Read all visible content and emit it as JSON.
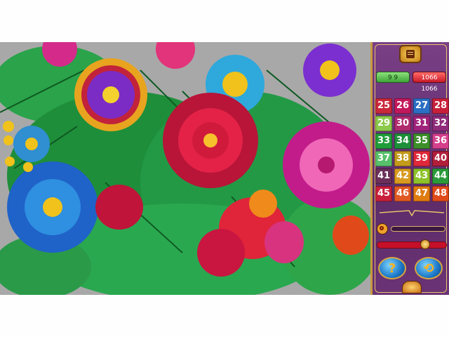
{
  "game": {
    "counters": {
      "placed": "9 9",
      "total": "1066 1066"
    },
    "number_cells": [
      {
        "number": "25",
        "color": "#c9283a"
      },
      {
        "number": "26",
        "color": "#c2185b"
      },
      {
        "number": "27",
        "color": "#2b6fc4"
      },
      {
        "number": "28",
        "color": "#c8203a"
      },
      {
        "number": "29",
        "color": "#8cc84a"
      },
      {
        "number": "30",
        "color": "#b02a6e"
      },
      {
        "number": "31",
        "color": "#a0237b"
      },
      {
        "number": "32",
        "color": "#8f2b7a"
      },
      {
        "number": "33",
        "color": "#1f9d3a"
      },
      {
        "number": "34",
        "color": "#1e8f3a"
      },
      {
        "number": "35",
        "color": "#3d8f2a"
      },
      {
        "number": "36",
        "color": "#d53f8c"
      },
      {
        "number": "37",
        "color": "#57c06a"
      },
      {
        "number": "38",
        "color": "#c39a1a"
      },
      {
        "number": "39",
        "color": "#e0283a"
      },
      {
        "number": "40",
        "color": "#b01e3a"
      },
      {
        "number": "41",
        "color": "#6b2f5a"
      },
      {
        "number": "42",
        "color": "#d89a20"
      },
      {
        "number": "43",
        "color": "#8cc22a"
      },
      {
        "number": "44",
        "color": "#2b9a3a"
      },
      {
        "number": "45",
        "color": "#c8203a"
      },
      {
        "number": "46",
        "color": "#e05a22"
      },
      {
        "number": "47",
        "color": "#e07b10"
      },
      {
        "number": "48",
        "color": "#e04a1a"
      }
    ],
    "zoom_level": 0,
    "slider_level": 0.72,
    "icons": {
      "menu": "menu-book-icon",
      "zoom": "magnifier-icon",
      "help": "question-mark-icon",
      "hint": "arrows-hint-icon",
      "emblem": "gear-emblem-icon"
    },
    "help_glyph": "?",
    "hint_glyph": "⟲"
  }
}
